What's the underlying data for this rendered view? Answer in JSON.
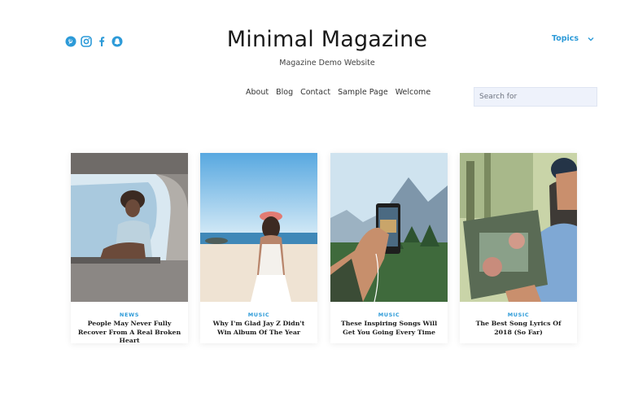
{
  "header": {
    "site_title": "Minimal Magazine",
    "tagline": "Magazine Demo Website",
    "topics_label": "Topics"
  },
  "social": {
    "icons": [
      "pinterest-icon",
      "instagram-icon",
      "facebook-icon",
      "snapchat-icon"
    ],
    "color": "#2c9ad8"
  },
  "nav": {
    "items": [
      "About",
      "Blog",
      "Contact",
      "Sample Page",
      "Welcome"
    ]
  },
  "search": {
    "placeholder": "Search for"
  },
  "accent_color": "#2c9ad8",
  "posts": [
    {
      "category": "NEWS",
      "title": "People May Never Fully Recover From A Real Broken Heart"
    },
    {
      "category": "MUSIC",
      "title": "Why I'm Glad Jay Z Didn't Win Album Of The Year"
    },
    {
      "category": "MUSIC",
      "title": "These Inspiring Songs Will Get You Going Every Time"
    },
    {
      "category": "MUSIC",
      "title": "The Best Song Lyrics Of 2018 (So Far)"
    }
  ]
}
